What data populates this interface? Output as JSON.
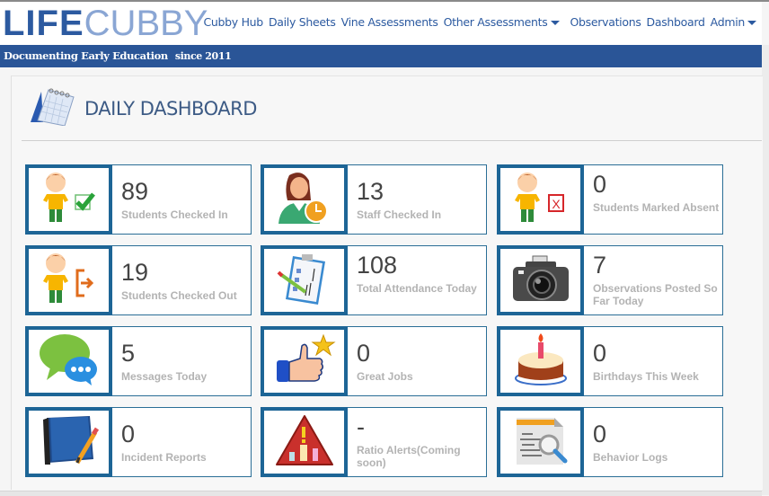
{
  "brand": {
    "part1": "LIFE",
    "part2": "CUBBY",
    "tagline": "Documenting Early Education",
    "since": "since 2011"
  },
  "nav": [
    {
      "label": "Cubby Hub",
      "dropdown": false
    },
    {
      "label": "Daily Sheets",
      "dropdown": false
    },
    {
      "label": "Vine Assessments",
      "dropdown": false
    },
    {
      "label": "Other Assessments",
      "dropdown": true
    },
    {
      "label": "Observations",
      "dropdown": false
    },
    {
      "label": "Dashboard",
      "dropdown": false
    },
    {
      "label": "Admin",
      "dropdown": true
    }
  ],
  "page": {
    "title": "DAILY DASHBOARD",
    "icon": "calendar-icon"
  },
  "colors": {
    "brand_blue": "#2a5597",
    "tile_border": "#1d6596",
    "link": "#2c5aa0"
  },
  "tiles": [
    {
      "value": "89",
      "label": "Students Checked In",
      "icon": "student-checked-in-icon"
    },
    {
      "value": "13",
      "label": "Staff Checked In",
      "icon": "staff-clock-icon"
    },
    {
      "value": "0",
      "label": "Students Marked Absent",
      "icon": "student-absent-icon"
    },
    {
      "value": "19",
      "label": "Students Checked Out",
      "icon": "student-checked-out-icon"
    },
    {
      "value": "108",
      "label": "Total Attendance Today",
      "icon": "attendance-clipboard-icon"
    },
    {
      "value": "7",
      "label": "Observations Posted So Far Today",
      "icon": "camera-icon"
    },
    {
      "value": "5",
      "label": "Messages Today",
      "icon": "chat-bubbles-icon"
    },
    {
      "value": "0",
      "label": "Great Jobs",
      "icon": "thumbs-up-star-icon"
    },
    {
      "value": "0",
      "label": "Birthdays This Week",
      "icon": "birthday-cake-icon"
    },
    {
      "value": "0",
      "label": "Incident Reports",
      "icon": "notebook-pencil-icon"
    },
    {
      "value": "-",
      "label": "Ratio Alerts(Coming soon)",
      "icon": "warning-chart-icon"
    },
    {
      "value": "0",
      "label": "Behavior Logs",
      "icon": "document-search-icon"
    }
  ]
}
